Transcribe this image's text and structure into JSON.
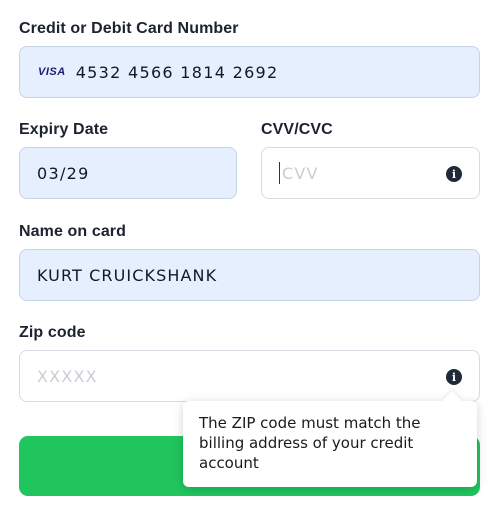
{
  "card": {
    "label": "Credit or Debit Card Number",
    "brand": "VISA",
    "value": "4532 4566 1814 2692"
  },
  "expiry": {
    "label": "Expiry Date",
    "value": "03/29"
  },
  "cvv": {
    "label": "CVV/CVC",
    "placeholder": "CVV",
    "info_icon": "info-icon"
  },
  "name": {
    "label": "Name on card",
    "value": "KURT CRUICKSHANK"
  },
  "zip": {
    "label": "Zip code",
    "placeholder": "XXXXX",
    "info_icon": "info-icon"
  },
  "tooltip": {
    "text": "The ZIP code must match the billing address of your credit account"
  },
  "submit": {
    "label": ""
  },
  "colors": {
    "filled_field": "#e6effd",
    "submit_green": "#20c55e",
    "text": "#1c2230"
  }
}
